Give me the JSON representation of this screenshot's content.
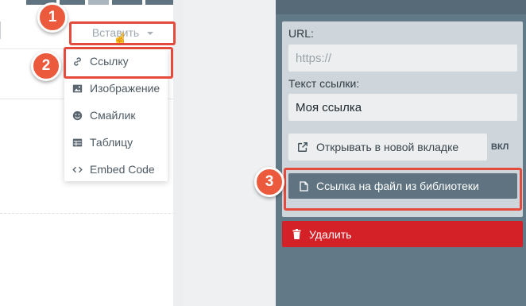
{
  "editor": {
    "insert_label": "Вставить",
    "dropdown": [
      {
        "label": "Ссылку",
        "icon": "link-icon"
      },
      {
        "label": "Изображение",
        "icon": "image-icon"
      },
      {
        "label": "Смайлик",
        "icon": "smiley-icon"
      },
      {
        "label": "Таблицу",
        "icon": "table-icon"
      },
      {
        "label": "Embed Code",
        "icon": "code-icon"
      }
    ]
  },
  "panel": {
    "url_label": "URL:",
    "url_placeholder": "https://",
    "link_text_label": "Текст ссылки:",
    "link_text_value": "Моя ссылка",
    "new_tab_label": "Открывать в новой вкладке",
    "new_tab_state": "ВКЛ",
    "file_link_label": "Ссылка на файл из библиотеки",
    "delete_label": "Удалить"
  },
  "callouts": [
    "1",
    "2",
    "3"
  ],
  "colors": {
    "panel_bg": "#627987",
    "delete_red": "#d42128",
    "callout": "#e54b3c"
  }
}
